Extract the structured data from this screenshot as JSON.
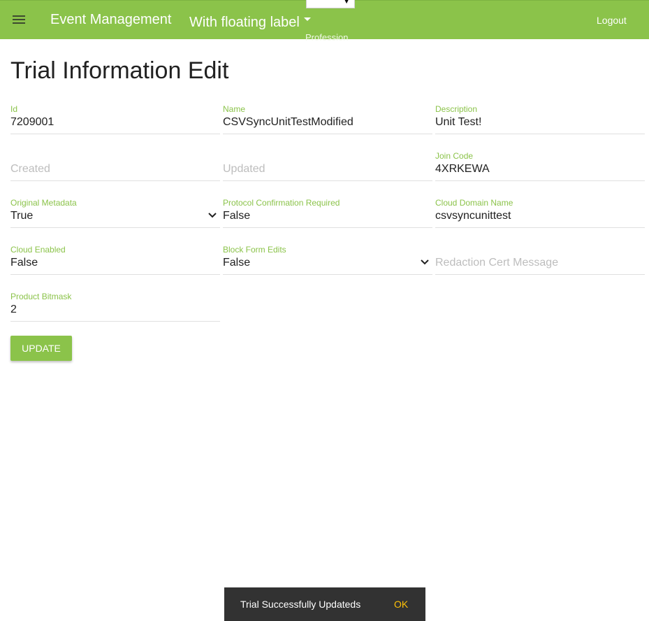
{
  "header": {
    "app_title": "Event Management",
    "floating_menu_label": "With floating label",
    "top_select_value": "",
    "profession_label": "Profession",
    "logout_label": "Logout"
  },
  "page": {
    "title": "Trial Information Edit"
  },
  "fields": {
    "id": {
      "label": "Id",
      "value": "7209001"
    },
    "name": {
      "label": "Name",
      "value": "CSVSyncUnitTestModified"
    },
    "description": {
      "label": "Description",
      "value": "Unit Test!"
    },
    "created": {
      "placeholder": "Created"
    },
    "updated": {
      "placeholder": "Updated"
    },
    "join_code": {
      "label": "Join Code",
      "value": "4XRKEWA"
    },
    "original_metadata": {
      "label": "Original Metadata",
      "value": "True"
    },
    "protocol_confirmation": {
      "label": "Protocol Confirmation Required",
      "value": "False"
    },
    "cloud_domain_name": {
      "label": "Cloud Domain Name",
      "value": "csvsyncunittest"
    },
    "cloud_enabled": {
      "label": "Cloud Enabled",
      "value": "False"
    },
    "block_form_edits": {
      "label": "Block Form Edits",
      "value": "False"
    },
    "redaction_cert_message": {
      "placeholder": "Redaction Cert Message"
    },
    "product_bitmask": {
      "label": "Product Bitmask",
      "value": "2"
    }
  },
  "actions": {
    "update_label": "UPDATE"
  },
  "snackbar": {
    "message": "Trial Successfully Updateds",
    "action_label": "OK"
  },
  "colors": {
    "primary": "#8bc34a",
    "snackbar_bg": "#323232",
    "snackbar_action": "#ffc107"
  },
  "icons": {
    "menu": "hamburger-menu-icon",
    "dropdown": "chevron-down-icon",
    "caret": "caret-down-icon"
  }
}
